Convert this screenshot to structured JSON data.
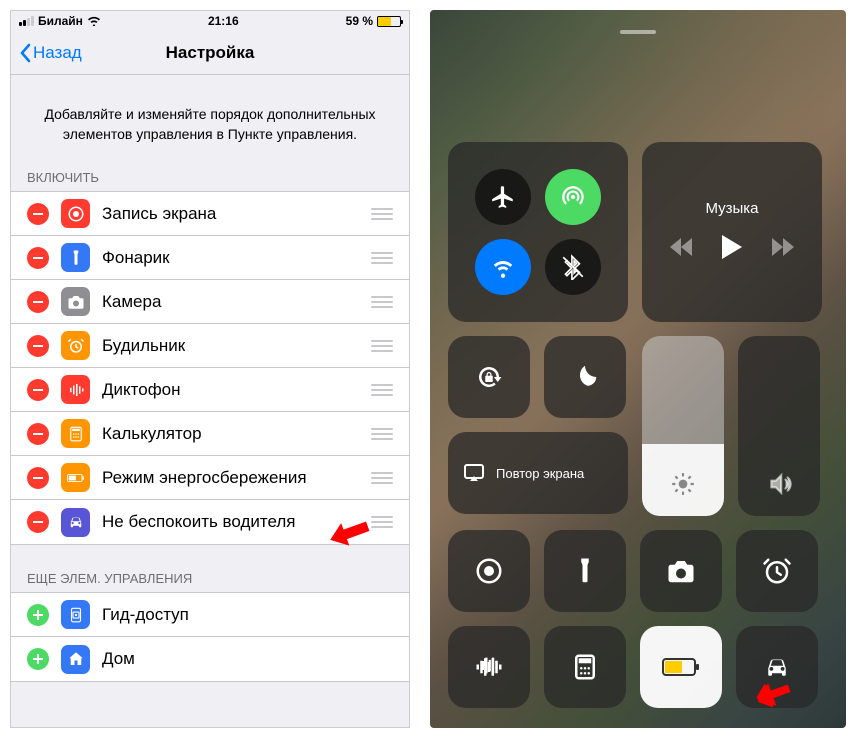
{
  "status": {
    "carrier": "Билайн",
    "time": "21:16",
    "battery_pct": "59 %"
  },
  "nav": {
    "back": "Назад",
    "title": "Настройка"
  },
  "description": "Добавляйте и изменяйте порядок дополнительных элементов управления в Пункте управления.",
  "sections": {
    "included": "ВКЛЮЧИТЬ",
    "more": "ЕЩЕ ЭЛЕМ. УПРАВЛЕНИЯ"
  },
  "included": [
    {
      "label": "Запись экрана",
      "icon": "record",
      "color": "#ff3b30"
    },
    {
      "label": "Фонарик",
      "icon": "flashlight",
      "color": "#3478f6"
    },
    {
      "label": "Камера",
      "icon": "camera",
      "color": "#8e8e93"
    },
    {
      "label": "Будильник",
      "icon": "alarm",
      "color": "#ff9500"
    },
    {
      "label": "Диктофон",
      "icon": "voice",
      "color": "#ff3b30"
    },
    {
      "label": "Калькулятор",
      "icon": "calculator",
      "color": "#ff9500"
    },
    {
      "label": "Режим энергосбережения",
      "icon": "lowpower",
      "color": "#ff9500"
    },
    {
      "label": "Не беспокоить водителя",
      "icon": "car",
      "color": "#5856d6"
    }
  ],
  "more": [
    {
      "label": "Гид-доступ",
      "icon": "guided",
      "color": "#3478f6"
    },
    {
      "label": "Дом",
      "icon": "home",
      "color": "#3478f6"
    }
  ],
  "cc": {
    "music": "Музыка",
    "mirror": "Повтор экрана"
  }
}
